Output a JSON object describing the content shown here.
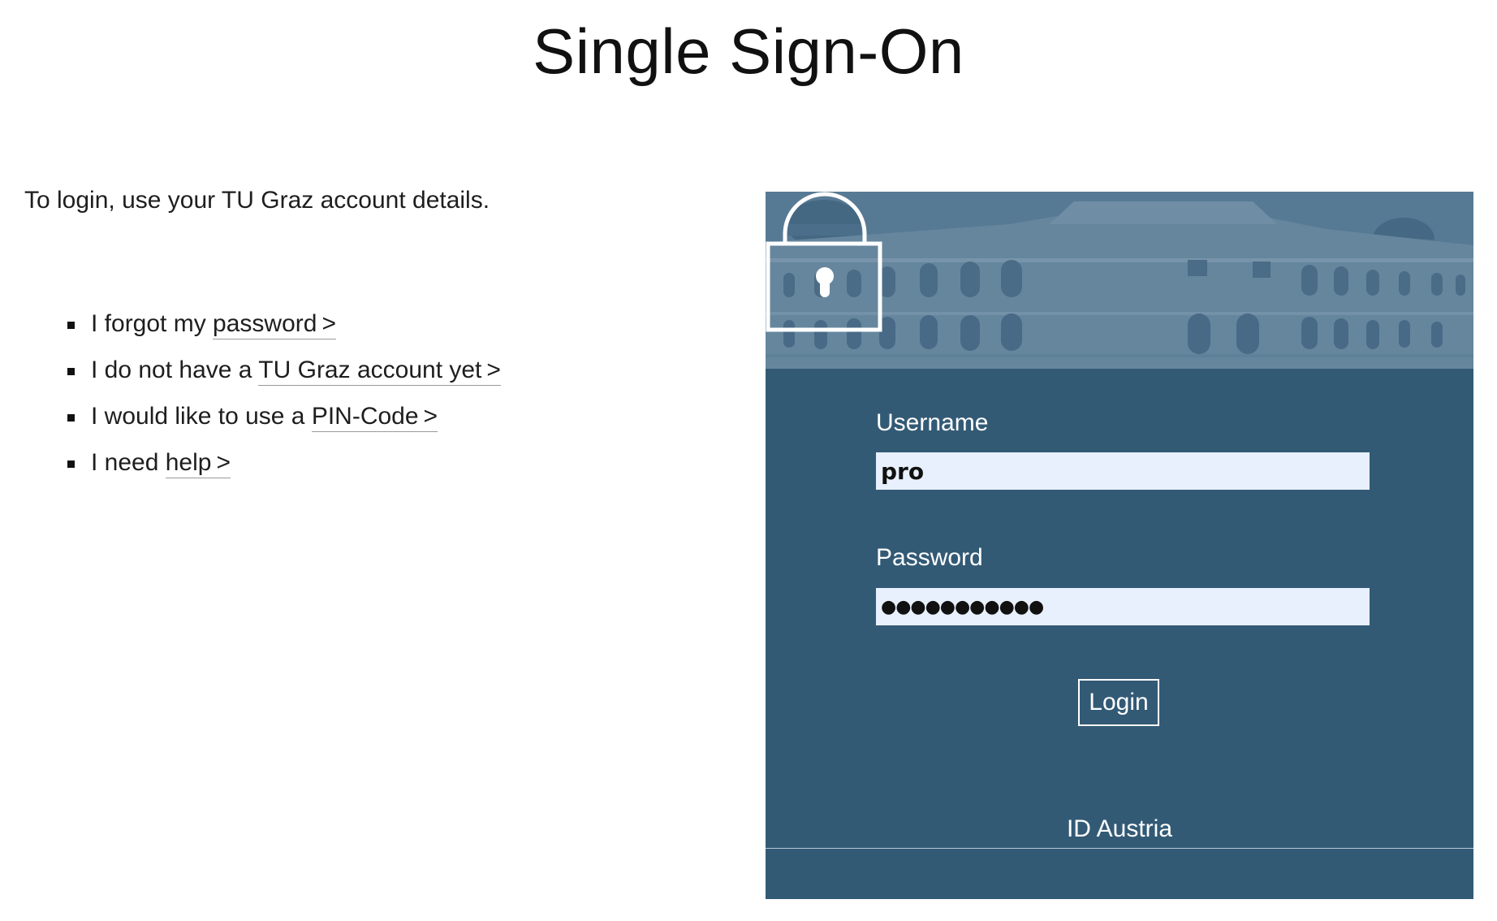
{
  "page": {
    "title": "Single Sign-On",
    "intro": "To login, use your TU Graz account details."
  },
  "links": [
    {
      "prefix": "I forgot my ",
      "link": "password",
      "chevron": ">"
    },
    {
      "prefix": "I do not have a ",
      "link": "TU Graz account yet",
      "chevron": ">"
    },
    {
      "prefix": "I would like to use a ",
      "link": "PIN-Code",
      "chevron": ">"
    },
    {
      "prefix": "I need ",
      "link": "help",
      "chevron": ">"
    }
  ],
  "login": {
    "username_label": "Username",
    "username_value": "pro",
    "password_label": "Password",
    "password_value": "●●●●●●●●●●●",
    "login_button": "Login",
    "alt_login": "ID Austria"
  },
  "colors": {
    "panel": "#335a75",
    "input_bg": "#e8f0fd"
  },
  "icons": {
    "lock": "lock-icon",
    "banner": "university-building-image"
  }
}
